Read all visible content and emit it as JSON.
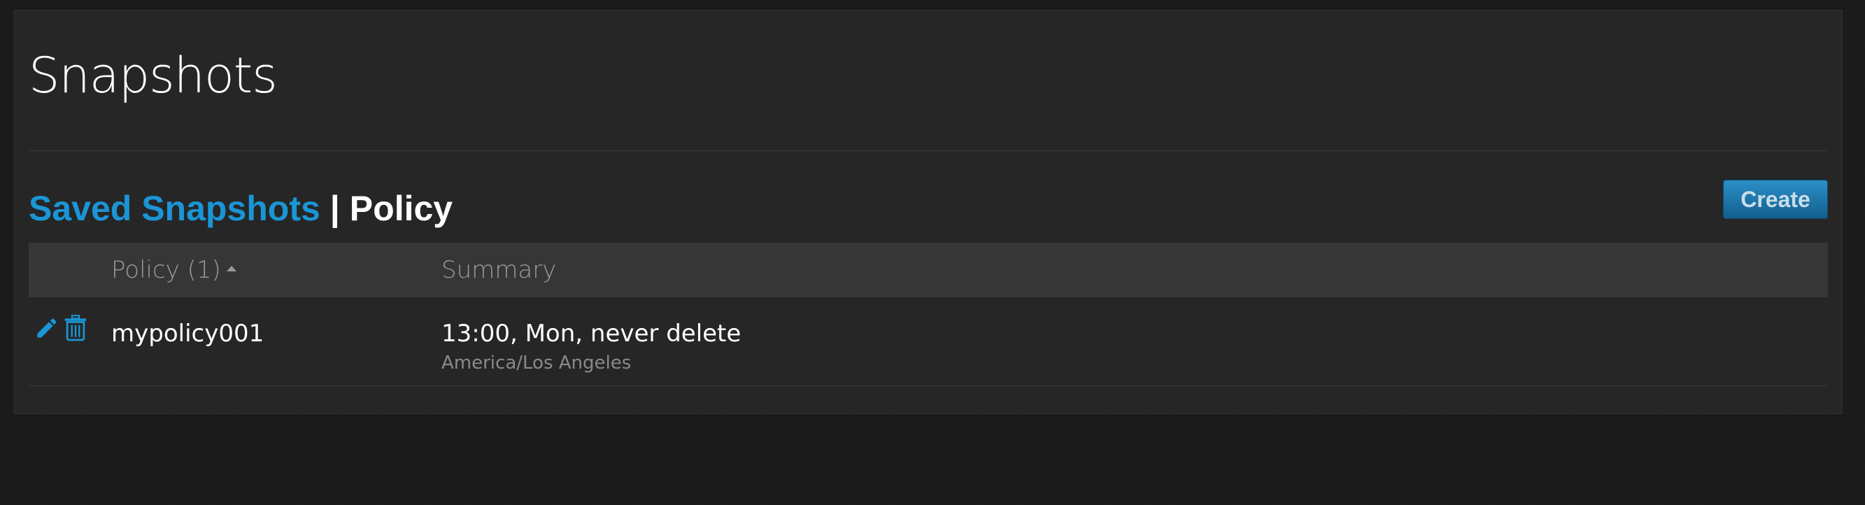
{
  "page": {
    "title": "Snapshots"
  },
  "section": {
    "saved_snapshots_link": "Saved Snapshots",
    "separator": "|",
    "current": "Policy",
    "create_label": "Create"
  },
  "table": {
    "columns": [
      {
        "label": "Policy (1)",
        "sorted": "ascending"
      },
      {
        "label": "Summary"
      }
    ],
    "rows": [
      {
        "policy": "mypolicy001",
        "summary": "13:00, Mon, never delete",
        "timezone": "America/Los Angeles",
        "actions": [
          "pencil-icon",
          "trash-icon"
        ]
      }
    ]
  },
  "colors": {
    "accent": "#1a95d6",
    "panel_bg": "#262626",
    "header_row_bg": "#363636",
    "page_bg": "#1a1a1a",
    "create_button": "#1f76a8"
  }
}
